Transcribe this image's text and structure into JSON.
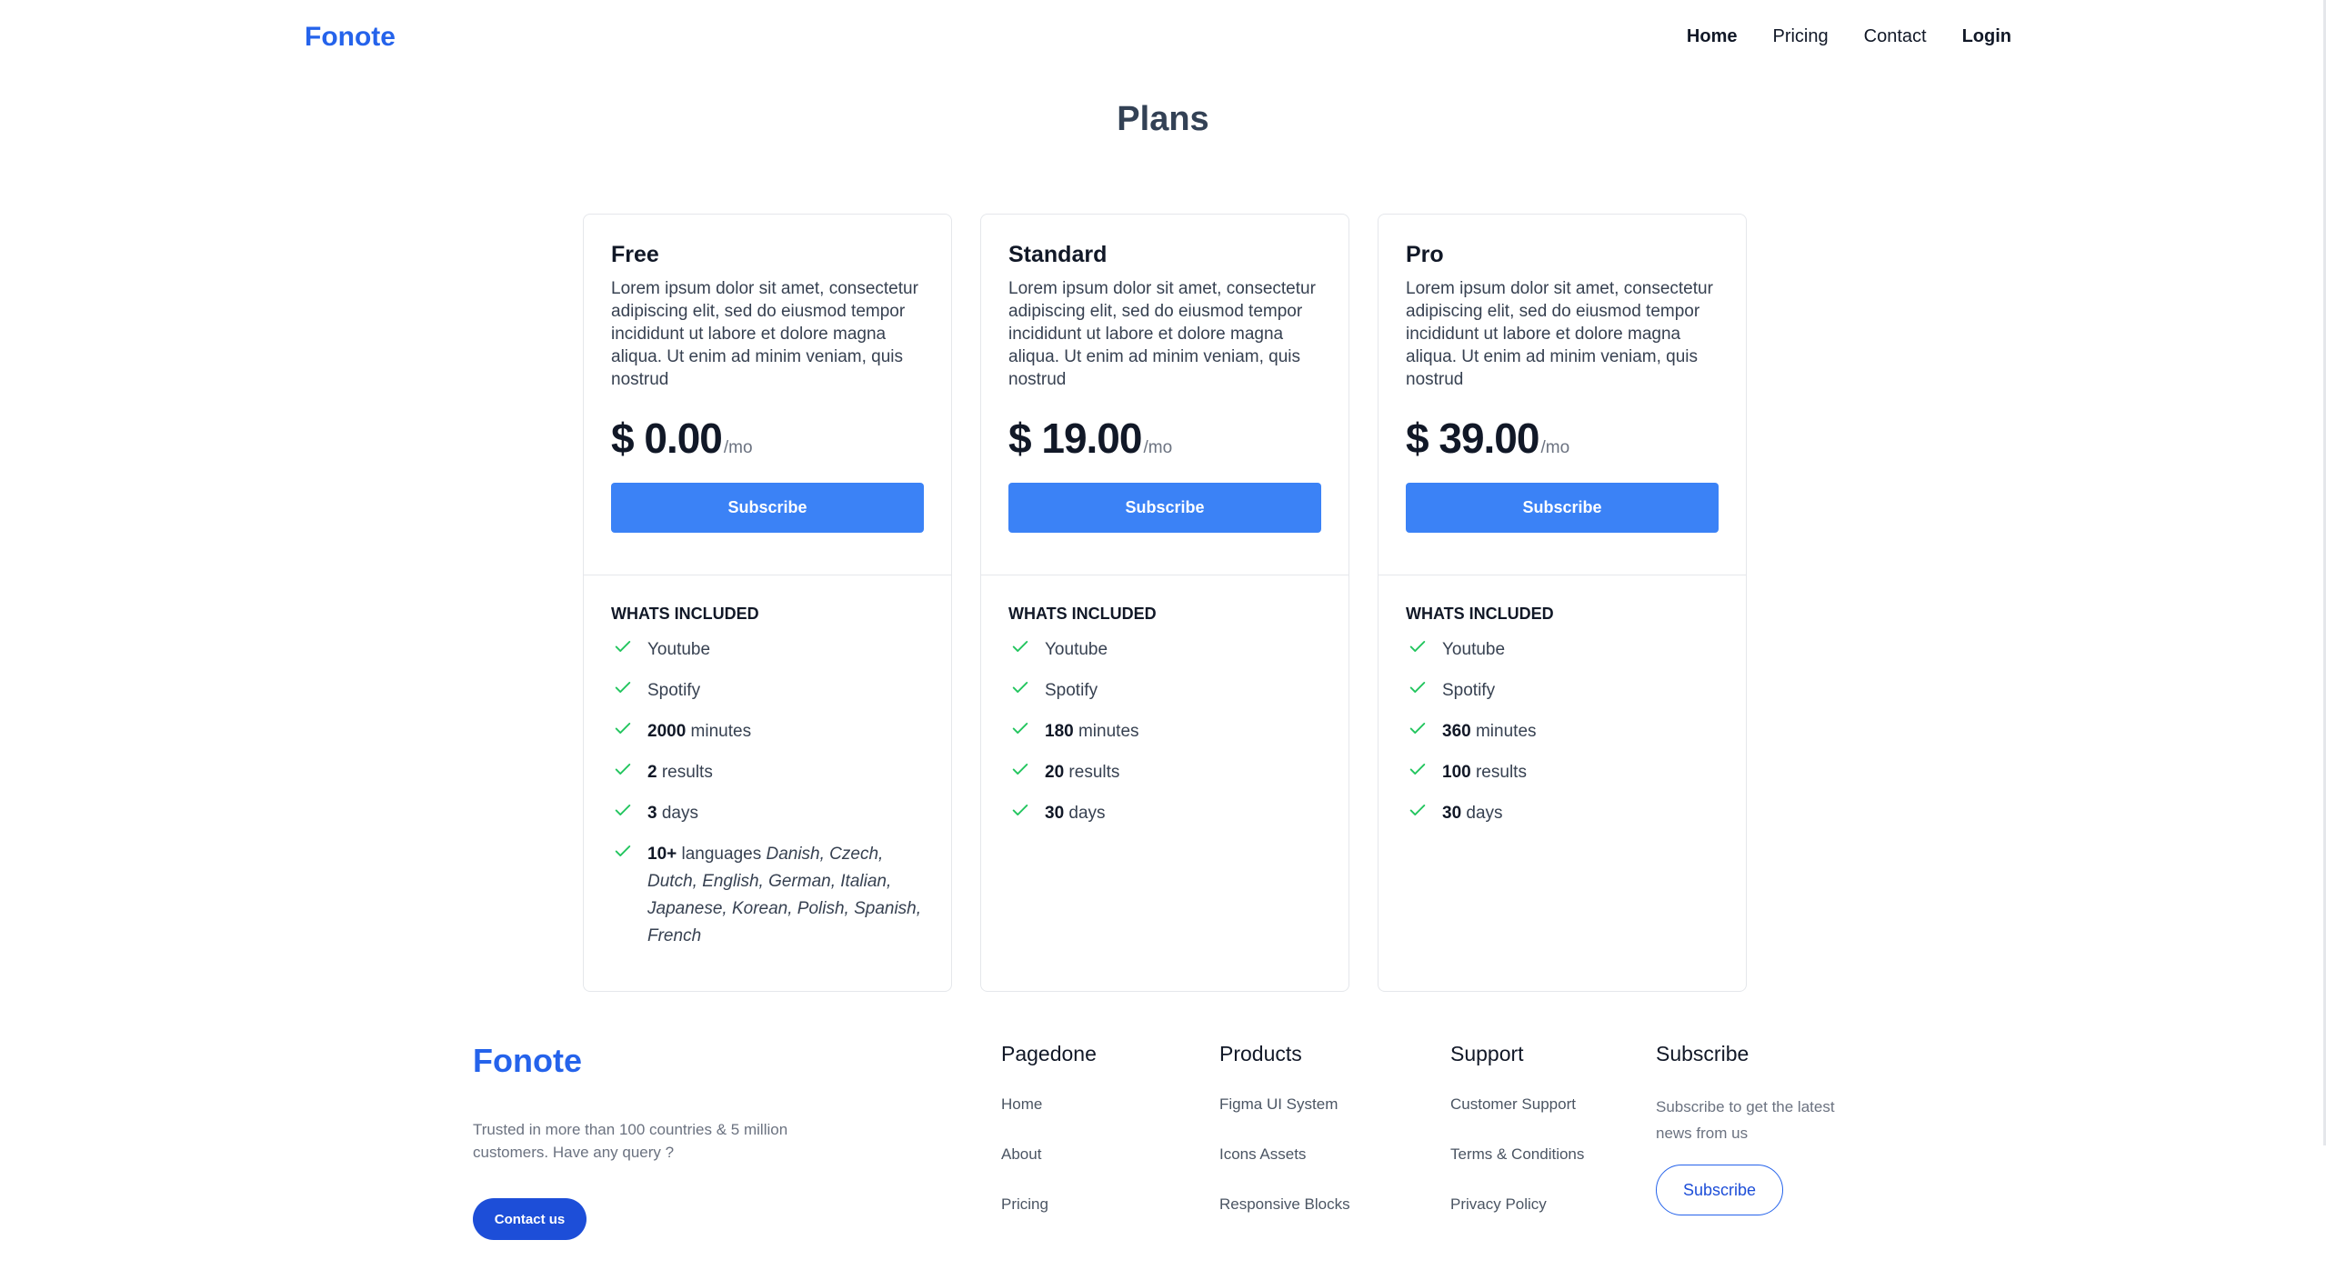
{
  "nav": {
    "brand": "Fonote",
    "links": [
      "Home",
      "Pricing",
      "Contact",
      "Login"
    ]
  },
  "page_title": "Plans",
  "plans": [
    {
      "name": "Free",
      "description": "Lorem ipsum dolor sit amet, consectetur adipiscing elit, sed do eiusmod tempor incididunt ut labore et dolore magna aliqua. Ut enim ad minim veniam, quis nostrud",
      "price": "$ 0.00",
      "per": "/mo",
      "button": "Subscribe",
      "included_title": "WHATS INCLUDED",
      "features": [
        {
          "bold": "",
          "text": "Youtube",
          "extra": ""
        },
        {
          "bold": "",
          "text": "Spotify",
          "extra": ""
        },
        {
          "bold": "2000",
          "text": " minutes",
          "extra": ""
        },
        {
          "bold": "2",
          "text": " results",
          "extra": ""
        },
        {
          "bold": "3",
          "text": " days",
          "extra": ""
        },
        {
          "bold": "10+",
          "text": " languages ",
          "extra": "Danish, Czech, Dutch, English, German, Italian, Japanese, Korean, Polish, Spanish, French"
        }
      ]
    },
    {
      "name": "Standard",
      "description": "Lorem ipsum dolor sit amet, consectetur adipiscing elit, sed do eiusmod tempor incididunt ut labore et dolore magna aliqua. Ut enim ad minim veniam, quis nostrud",
      "price": "$ 19.00",
      "per": "/mo",
      "button": "Subscribe",
      "included_title": "WHATS INCLUDED",
      "features": [
        {
          "bold": "",
          "text": "Youtube",
          "extra": ""
        },
        {
          "bold": "",
          "text": "Spotify",
          "extra": ""
        },
        {
          "bold": "180",
          "text": " minutes",
          "extra": ""
        },
        {
          "bold": "20",
          "text": " results",
          "extra": ""
        },
        {
          "bold": "30",
          "text": " days",
          "extra": ""
        }
      ]
    },
    {
      "name": "Pro",
      "description": "Lorem ipsum dolor sit amet, consectetur adipiscing elit, sed do eiusmod tempor incididunt ut labore et dolore magna aliqua. Ut enim ad minim veniam, quis nostrud",
      "price": "$ 39.00",
      "per": "/mo",
      "button": "Subscribe",
      "included_title": "WHATS INCLUDED",
      "features": [
        {
          "bold": "",
          "text": "Youtube",
          "extra": ""
        },
        {
          "bold": "",
          "text": "Spotify",
          "extra": ""
        },
        {
          "bold": "360",
          "text": " minutes",
          "extra": ""
        },
        {
          "bold": "100",
          "text": " results",
          "extra": ""
        },
        {
          "bold": "30",
          "text": " days",
          "extra": ""
        }
      ]
    }
  ],
  "footer": {
    "brand": "Fonote",
    "tagline": "Trusted in more than 100 countries & 5 million customers. Have any query ?",
    "contact_button": "Contact us",
    "columns": [
      {
        "title": "Pagedone",
        "links": [
          "Home",
          "About",
          "Pricing"
        ]
      },
      {
        "title": "Products",
        "links": [
          "Figma UI System",
          "Icons Assets",
          "Responsive Blocks"
        ]
      },
      {
        "title": "Support",
        "links": [
          "Customer Support",
          "Terms & Conditions",
          "Privacy Policy"
        ]
      }
    ],
    "subscribe": {
      "title": "Subscribe",
      "text": "Subscribe to get the latest news from us",
      "button": "Subscribe"
    }
  },
  "colors": {
    "brand": "#2563eb",
    "button": "#3b82f6",
    "check": "#22c55e"
  },
  "icons": {
    "feature": "check-icon"
  }
}
